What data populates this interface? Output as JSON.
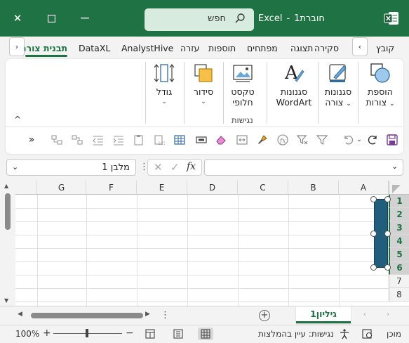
{
  "titlebar": {
    "close": "✕",
    "maximize": "☐",
    "minimize": "—",
    "search_placeholder": "חפש",
    "doc_name": "חוברת1",
    "separator": "-",
    "app_name": "Excel",
    "bg_color": "#1f7244"
  },
  "tabs": {
    "items": [
      "קובץ",
      "סקירה",
      "תצוגה",
      "מפתחים",
      "תוספות",
      "עזרה",
      "AnalystHive",
      "DataXL",
      "תבנית צורה"
    ],
    "active": "תבנית צורה",
    "scroll_left": "‹",
    "scroll_right": "›"
  },
  "ribbon": {
    "insert_shapes": [
      "הוספת",
      "צורות"
    ],
    "shape_styles": [
      "סגנונות",
      "צורה"
    ],
    "wordart_styles": [
      "סגנונות",
      "WordArt"
    ],
    "alt_text": [
      "טקסט",
      "חלופי"
    ],
    "arrange": "סידור",
    "size": "גודל",
    "accessibility_group": "נגישות",
    "collapse": "^",
    "more": "»"
  },
  "formula_bar": {
    "name_box": "מלבן 1",
    "fx": "fx",
    "formula": ""
  },
  "grid": {
    "columns": [
      "A",
      "B",
      "C",
      "D",
      "E",
      "F",
      "G"
    ],
    "rows": [
      "1",
      "2",
      "3",
      "4",
      "5",
      "6",
      "7",
      "8"
    ]
  },
  "sheets": {
    "active": "גיליון1",
    "add": "+",
    "more": "⋮"
  },
  "status": {
    "ready": "מוכן",
    "accessibility": "נגישות: עיין בהמלצות",
    "zoom": "100%",
    "zoom_in": "+",
    "zoom_out": "−"
  }
}
